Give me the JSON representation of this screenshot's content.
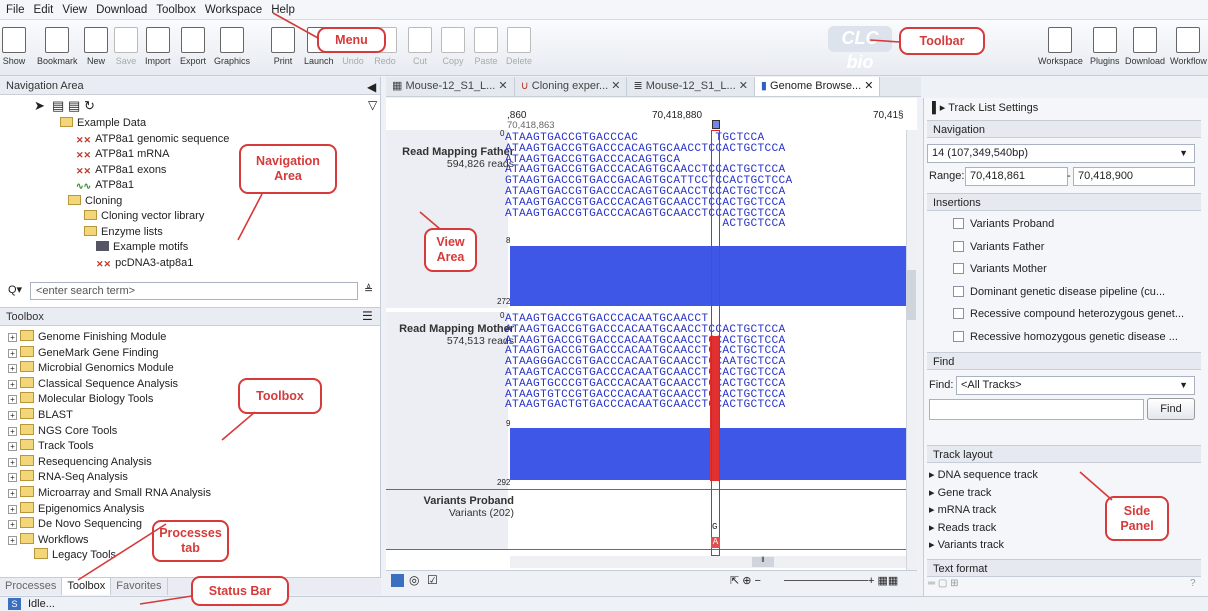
{
  "menu": [
    "File",
    "Edit",
    "View",
    "Download",
    "Toolbox",
    "Workspace",
    "Help"
  ],
  "toolbar": {
    "left": [
      "Show",
      "Bookmark",
      "New",
      "Save",
      "Import",
      "Export",
      "Graphics",
      "Print",
      "Launch",
      "Undo",
      "Redo",
      "Cut",
      "Copy",
      "Paste",
      "Delete"
    ],
    "right": [
      "Workspace",
      "Plugins",
      "Download",
      "Workflow"
    ],
    "logo": "CLC bio"
  },
  "nav": {
    "title": "Navigation Area",
    "tree": [
      "Example Data",
      "ATP8a1 genomic sequence",
      "ATP8a1 mRNA",
      "ATP8a1 exons",
      "ATP8a1",
      "Cloning",
      "Cloning vector library",
      "Enzyme lists",
      "Example motifs",
      "pcDNA3-atp8a1"
    ],
    "search_placeholder": "<enter search term>"
  },
  "toolbox": {
    "title": "Toolbox",
    "items": [
      "Genome Finishing Module",
      "GeneMark Gene Finding",
      "Microbial Genomics Module",
      "Classical Sequence Analysis",
      "Molecular Biology Tools",
      "BLAST",
      "NGS Core Tools",
      "Track Tools",
      "Resequencing Analysis",
      "RNA-Seq Analysis",
      "Microarray and Small RNA Analysis",
      "Epigenomics Analysis",
      "De Novo Sequencing",
      "Workflows",
      "Legacy Tools"
    ],
    "tabs": [
      "Processes",
      "Toolbox",
      "Favorites"
    ]
  },
  "status": "Idle...",
  "doc_tabs": [
    "Mouse-12_S1_L...",
    "Cloning exper...",
    "Mouse-12_S1_L...",
    "Genome Browse..."
  ],
  "view": {
    "ruler": {
      "left": ",860",
      "mid": "70,418,880",
      "right": "70,41§",
      "sub": "70,418,863"
    },
    "father": {
      "label": "Read Mapping Father",
      "reads": "594,826 reads",
      "zero": "0",
      "eight": "8",
      "max": "272",
      "seqs": [
        "ATAAGTGACCGTGACCCAC           TGCTCCA",
        "ATAAGTGACCGTGACCCACAGTGCAACCTCCACTGCTCCA",
        "ATAAGTGACCGTGACCCACAGTGCA",
        "ATAAGTGACCGTGACCCACAGTGCAACCTCCACTGCTCCA",
        "GTAAGTGACCGTGACCGACAGTGCATTCCTCCACTGCTCCA",
        "ATAAGTGACCGTGACCCACAGTGCAACCTCCACTGCTCCA",
        "ATAAGTGACCGTGACCCACAGTGCAACCTCCACTGCTCCA",
        "ATAAGTGACCGTGACCCACAGTGCAACCTCCACTGCTCCA",
        "                               ACTGCTCCA"
      ]
    },
    "mother": {
      "label": "Read Mapping Mother",
      "reads": "574,513 reads",
      "zero": "0",
      "nine": "9",
      "max": "292",
      "seqs": [
        "ATAAGTGACCGTGACCCACAATGCAACCT",
        "ATAAGTGACCGTGACCCACAATGCAACCTCCACTGCTCCA",
        "ATAAGTGACCGTGACCCACAATGCAACCTCCACTGCTCCA",
        "ATAAGTGACCGTGACCCACAATGCAACCTCCACTGCTCCA",
        "ATAAGGGACCGTGACCCACAATGCAACCTCCAATGCTCCA",
        "ATAAGTCACCGTGACCCACAATGCAACCTCCACTGCTCCA",
        "ATAAGTGCCCGTGACCCACAATGCAACCTCCACTGCTCCA",
        "ATAAGTGTCCGTGACCCACAATGCAACCTCCACTGCTCCA",
        "ATAAGTGACTGTGACCCACAATGCAACCTCCACTGCTCCA"
      ]
    },
    "proband": {
      "label": "Variants Proband",
      "sub": "Variants (202)",
      "g": "G",
      "a": "A"
    }
  },
  "side": {
    "title": "Track List Settings",
    "navigation": {
      "title": "Navigation",
      "chrom": "14 (107,349,540bp)",
      "range_label": "Range:",
      "from": "70,418,861",
      "to": "70,418,900"
    },
    "insertions": {
      "title": "Insertions",
      "items": [
        "Variants Proband",
        "Variants Father",
        "Variants Mother",
        "Dominant genetic disease pipeline (cu...",
        "Recessive compound heterozygous genet...",
        "Recessive homozygous genetic disease ..."
      ]
    },
    "find": {
      "title": "Find",
      "label": "Find:",
      "select": "<All Tracks>",
      "button": "Find"
    },
    "layout": {
      "title": "Track layout",
      "items": [
        "DNA sequence track",
        "Gene track",
        "mRNA track",
        "Reads track",
        "Variants track"
      ]
    },
    "text_format": "Text format"
  },
  "callouts": {
    "menu": "Menu",
    "toolbar": "Toolbar",
    "nav": "Navigation Area",
    "view": "View Area",
    "toolbox": "Toolbox",
    "processes": "Processes tab",
    "status": "Status Bar",
    "side": "Side Panel"
  }
}
